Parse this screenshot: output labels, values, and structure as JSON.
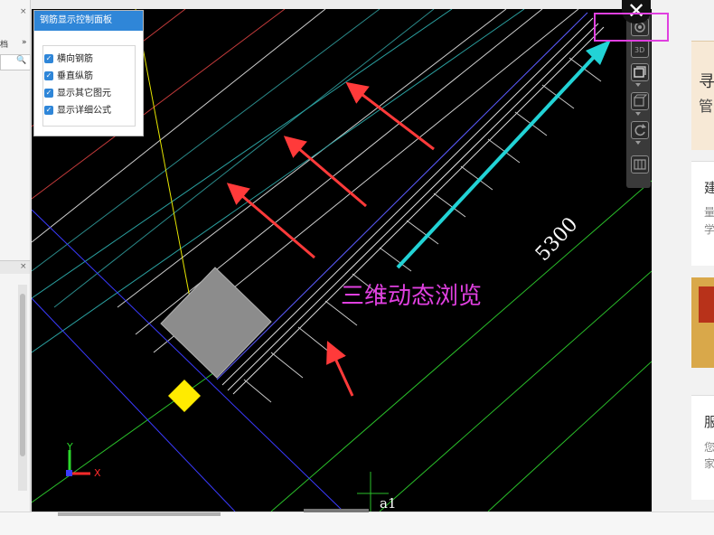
{
  "left_panel": {
    "close_glyph": "×",
    "tab_text": "档",
    "tab_arrow": "»",
    "search_icon": "🔍",
    "close_glyph_2": "×"
  },
  "control_panel": {
    "title": "钢筋显示控制面板",
    "options": [
      {
        "label": "横向钢筋",
        "checked": true
      },
      {
        "label": "垂直纵筋",
        "checked": true
      },
      {
        "label": "显示其它图元",
        "checked": true
      },
      {
        "label": "显示详细公式",
        "checked": true
      }
    ]
  },
  "viewport": {
    "annotation": "三维动态浏览",
    "dimension_label": "5300",
    "axis_label": "a1",
    "axis_x": "X",
    "axis_y": "Y"
  },
  "toolbar": {
    "close_glyph": "✕",
    "icons": [
      "orbit-icon",
      "3d-view-icon",
      "box-view-icon",
      "cube-outline-icon",
      "rotate-icon",
      "grid-panel-icon"
    ],
    "label_3d": "3D"
  },
  "right_strip": {
    "snippets": [
      "寻",
      "管",
      "建",
      "量",
      "学",
      "服",
      "您",
      "家"
    ]
  },
  "colors": {
    "highlight": "#e040e0",
    "arrow_red": "#ff3a3a",
    "arrow_cyan": "#22d3d6",
    "panel_header": "#2f86d8"
  }
}
